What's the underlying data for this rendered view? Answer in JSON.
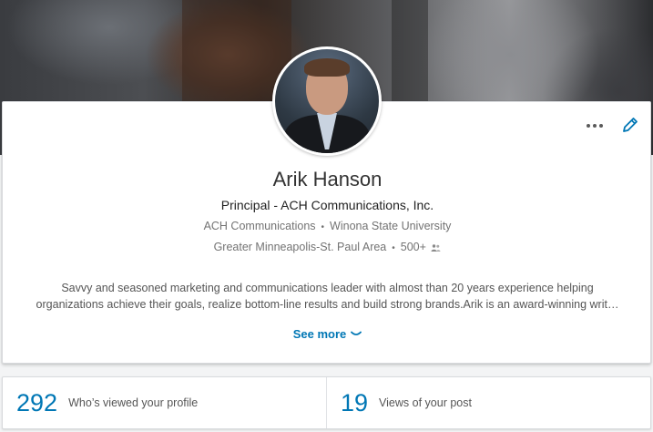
{
  "profile": {
    "name": "Arik Hanson",
    "headline": "Principal - ACH Communications, Inc.",
    "company": "ACH Communications",
    "school": "Winona State University",
    "location": "Greater Minneapolis-St. Paul Area",
    "connections": "500+",
    "summary_line1": "Savvy and seasoned marketing and communications leader with almost than 20 years experience helping",
    "summary_line2": "organizations achieve their goals, realize bottom-line results and build strong brands.Arik is an award-winning writ…",
    "see_more_label": "See more"
  },
  "stats": [
    {
      "value": "292",
      "label": "Who’s viewed your profile"
    },
    {
      "value": "19",
      "label": "Views of your post"
    }
  ],
  "colors": {
    "accent": "#0077b5",
    "text_muted": "#737373"
  },
  "icons": [
    "more-icon",
    "edit-pencil-icon",
    "connections-icon",
    "chevron-down-icon"
  ]
}
